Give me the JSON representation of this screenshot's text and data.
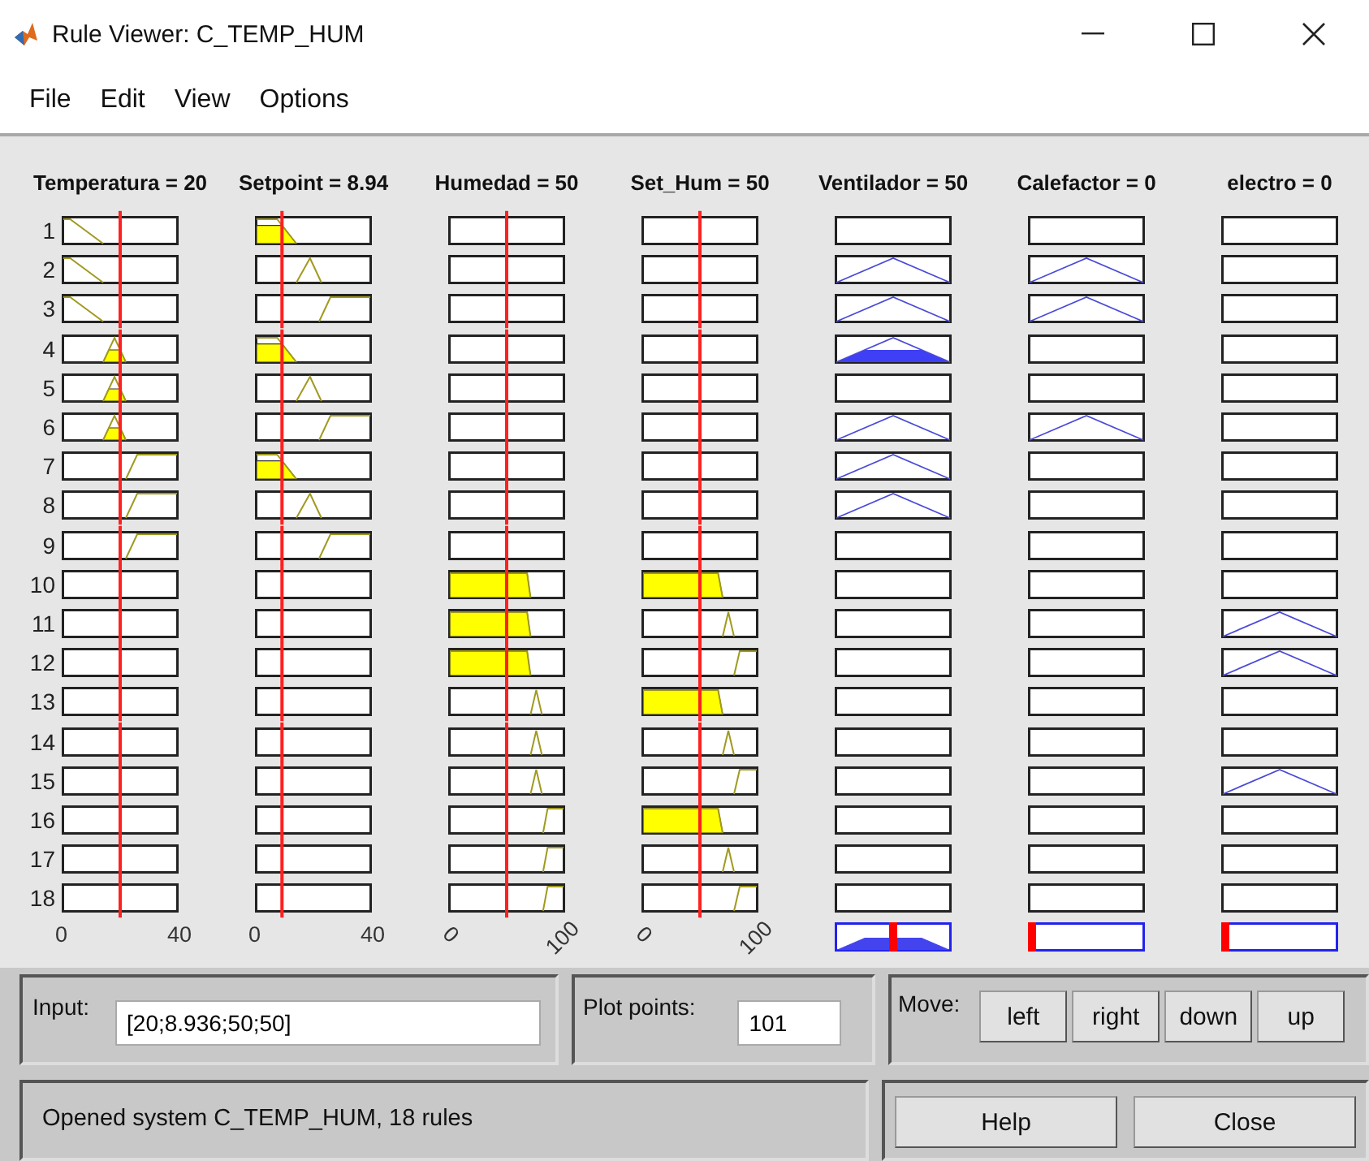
{
  "window": {
    "title": "Rule Viewer: C_TEMP_HUM"
  },
  "menu": [
    "File",
    "Edit",
    "View",
    "Options"
  ],
  "inputs": [
    {
      "label": "Temperatura = 20",
      "level": 0.5,
      "axis": {
        "min": "0",
        "max": "40",
        "slanted": false
      }
    },
    {
      "label": "Setpoint = 8.94",
      "level": 0.2235,
      "axis": {
        "min": "0",
        "max": "40",
        "slanted": false
      }
    },
    {
      "label": "Humedad = 50",
      "level": 0.5,
      "axis": {
        "min": "0",
        "max": "100",
        "slanted": true
      }
    },
    {
      "label": "Set_Hum = 50",
      "level": 0.5,
      "axis": {
        "min": "0",
        "max": "100",
        "slanted": true
      }
    }
  ],
  "outputs": [
    {
      "label": "Ventilador = 50",
      "level": 0.5
    },
    {
      "label": "Calefactor = 0",
      "level": 0
    },
    {
      "label": "electro = 0",
      "level": 0
    }
  ],
  "rules": [
    {
      "number": "1",
      "inputs": [
        {
          "kind": "low"
        },
        {
          "kind": "low"
        },
        {
          "kind": "empty"
        },
        {
          "kind": "empty"
        }
      ],
      "outputs": [
        {
          "kind": "empty"
        },
        {
          "kind": "empty"
        },
        {
          "kind": "empty"
        }
      ]
    },
    {
      "number": "2",
      "inputs": [
        {
          "kind": "low"
        },
        {
          "kind": "mid"
        },
        {
          "kind": "empty"
        },
        {
          "kind": "empty"
        }
      ],
      "outputs": [
        {
          "kind": "tri"
        },
        {
          "kind": "tri"
        },
        {
          "kind": "empty"
        }
      ]
    },
    {
      "number": "3",
      "inputs": [
        {
          "kind": "low"
        },
        {
          "kind": "high"
        },
        {
          "kind": "empty"
        },
        {
          "kind": "empty"
        }
      ],
      "outputs": [
        {
          "kind": "tri"
        },
        {
          "kind": "tri"
        },
        {
          "kind": "empty"
        }
      ]
    },
    {
      "number": "4",
      "inputs": [
        {
          "kind": "mid"
        },
        {
          "kind": "low"
        },
        {
          "kind": "empty"
        },
        {
          "kind": "empty"
        }
      ],
      "outputs": [
        {
          "kind": "tri"
        },
        {
          "kind": "empty"
        },
        {
          "kind": "empty"
        }
      ]
    },
    {
      "number": "5",
      "inputs": [
        {
          "kind": "mid"
        },
        {
          "kind": "mid"
        },
        {
          "kind": "empty"
        },
        {
          "kind": "empty"
        }
      ],
      "outputs": [
        {
          "kind": "empty"
        },
        {
          "kind": "empty"
        },
        {
          "kind": "empty"
        }
      ]
    },
    {
      "number": "6",
      "inputs": [
        {
          "kind": "mid"
        },
        {
          "kind": "high"
        },
        {
          "kind": "empty"
        },
        {
          "kind": "empty"
        }
      ],
      "outputs": [
        {
          "kind": "tri"
        },
        {
          "kind": "tri"
        },
        {
          "kind": "empty"
        }
      ]
    },
    {
      "number": "7",
      "inputs": [
        {
          "kind": "high"
        },
        {
          "kind": "low"
        },
        {
          "kind": "empty"
        },
        {
          "kind": "empty"
        }
      ],
      "outputs": [
        {
          "kind": "tri"
        },
        {
          "kind": "empty"
        },
        {
          "kind": "empty"
        }
      ]
    },
    {
      "number": "8",
      "inputs": [
        {
          "kind": "high"
        },
        {
          "kind": "mid"
        },
        {
          "kind": "empty"
        },
        {
          "kind": "empty"
        }
      ],
      "outputs": [
        {
          "kind": "tri"
        },
        {
          "kind": "empty"
        },
        {
          "kind": "empty"
        }
      ]
    },
    {
      "number": "9",
      "inputs": [
        {
          "kind": "high"
        },
        {
          "kind": "high"
        },
        {
          "kind": "empty"
        },
        {
          "kind": "empty"
        }
      ],
      "outputs": [
        {
          "kind": "empty"
        },
        {
          "kind": "empty"
        },
        {
          "kind": "empty"
        }
      ]
    },
    {
      "number": "10",
      "inputs": [
        {
          "kind": "empty"
        },
        {
          "kind": "empty"
        },
        {
          "kind": "low"
        },
        {
          "kind": "low"
        }
      ],
      "outputs": [
        {
          "kind": "empty"
        },
        {
          "kind": "empty"
        },
        {
          "kind": "empty"
        }
      ]
    },
    {
      "number": "11",
      "inputs": [
        {
          "kind": "empty"
        },
        {
          "kind": "empty"
        },
        {
          "kind": "low"
        },
        {
          "kind": "mid"
        }
      ],
      "outputs": [
        {
          "kind": "empty"
        },
        {
          "kind": "empty"
        },
        {
          "kind": "tri"
        }
      ]
    },
    {
      "number": "12",
      "inputs": [
        {
          "kind": "empty"
        },
        {
          "kind": "empty"
        },
        {
          "kind": "low"
        },
        {
          "kind": "high"
        }
      ],
      "outputs": [
        {
          "kind": "empty"
        },
        {
          "kind": "empty"
        },
        {
          "kind": "tri"
        }
      ]
    },
    {
      "number": "13",
      "inputs": [
        {
          "kind": "empty"
        },
        {
          "kind": "empty"
        },
        {
          "kind": "mid"
        },
        {
          "kind": "low"
        }
      ],
      "outputs": [
        {
          "kind": "empty"
        },
        {
          "kind": "empty"
        },
        {
          "kind": "empty"
        }
      ]
    },
    {
      "number": "14",
      "inputs": [
        {
          "kind": "empty"
        },
        {
          "kind": "empty"
        },
        {
          "kind": "mid"
        },
        {
          "kind": "mid"
        }
      ],
      "outputs": [
        {
          "kind": "empty"
        },
        {
          "kind": "empty"
        },
        {
          "kind": "empty"
        }
      ]
    },
    {
      "number": "15",
      "inputs": [
        {
          "kind": "empty"
        },
        {
          "kind": "empty"
        },
        {
          "kind": "mid"
        },
        {
          "kind": "high"
        }
      ],
      "outputs": [
        {
          "kind": "empty"
        },
        {
          "kind": "empty"
        },
        {
          "kind": "tri"
        }
      ]
    },
    {
      "number": "16",
      "inputs": [
        {
          "kind": "empty"
        },
        {
          "kind": "empty"
        },
        {
          "kind": "high"
        },
        {
          "kind": "low"
        }
      ],
      "outputs": [
        {
          "kind": "empty"
        },
        {
          "kind": "empty"
        },
        {
          "kind": "empty"
        }
      ]
    },
    {
      "number": "17",
      "inputs": [
        {
          "kind": "empty"
        },
        {
          "kind": "empty"
        },
        {
          "kind": "high"
        },
        {
          "kind": "mid"
        }
      ],
      "outputs": [
        {
          "kind": "empty"
        },
        {
          "kind": "empty"
        },
        {
          "kind": "empty"
        }
      ]
    },
    {
      "number": "18",
      "inputs": [
        {
          "kind": "empty"
        },
        {
          "kind": "empty"
        },
        {
          "kind": "high"
        },
        {
          "kind": "high"
        }
      ],
      "outputs": [
        {
          "kind": "empty"
        },
        {
          "kind": "empty"
        },
        {
          "kind": "empty"
        }
      ]
    }
  ],
  "input_panel": {
    "label": "Input:",
    "value": "[20;8.936;50;50]"
  },
  "plot_points": {
    "label": "Plot points:",
    "value": "101"
  },
  "move": {
    "label": "Move:",
    "buttons": [
      "left",
      "right",
      "down",
      "up"
    ]
  },
  "status": "Opened system C_TEMP_HUM, 18 rules",
  "buttons": [
    "Help",
    "Close"
  ]
}
